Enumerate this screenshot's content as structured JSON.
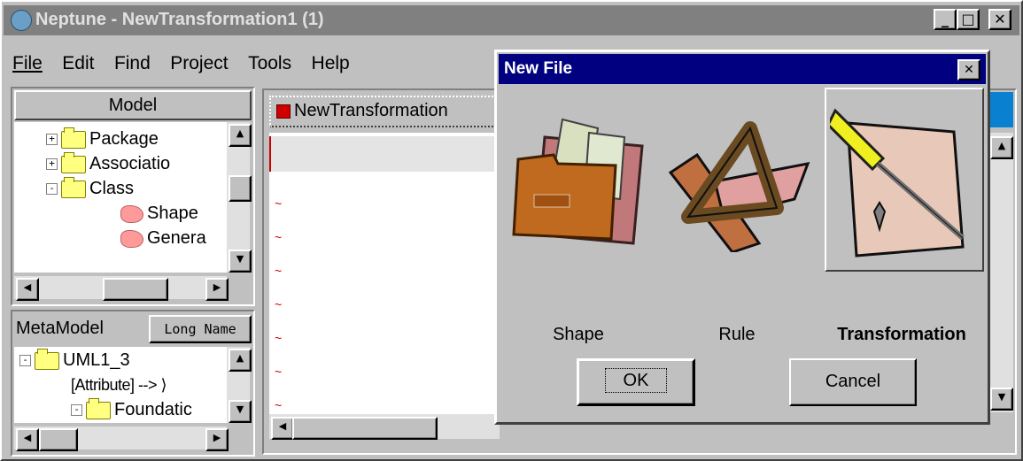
{
  "window": {
    "title": "Neptune - NewTransformation1 (1)",
    "controls": {
      "minimize": "_",
      "maximize": "□",
      "close": "✕"
    }
  },
  "menu": [
    "File",
    "Edit",
    "Find",
    "Project",
    "Tools",
    "Help"
  ],
  "model_panel": {
    "header": "Model",
    "items": [
      {
        "label": "Package",
        "icon": "folder-icon",
        "expand": "+"
      },
      {
        "label": "Associatio",
        "icon": "folder-icon",
        "expand": "+"
      },
      {
        "label": "Class",
        "icon": "open-folder-icon",
        "expand": "-"
      },
      {
        "label": "Shape",
        "icon": "shape-blob-icon"
      },
      {
        "label": "Genera",
        "icon": "shape-blob-icon"
      }
    ]
  },
  "metamodel_panel": {
    "header": "MetaModel",
    "long_name_button": "Long Name",
    "items": [
      {
        "label": "UML1_3",
        "icon": "open-folder-icon",
        "expand": "-"
      },
      {
        "label": "[Attribute] --> ⟩",
        "icon": ""
      },
      {
        "label": "Foundatic",
        "icon": "open-folder-icon",
        "expand": "-"
      }
    ]
  },
  "editor": {
    "tab_label": "NewTransformation"
  },
  "dialog": {
    "title": "New File",
    "options": [
      {
        "label": "Shape",
        "icon": "folder-papers-icon",
        "selected": false
      },
      {
        "label": "Rule",
        "icon": "set-square-ruler-icon",
        "selected": false
      },
      {
        "label": "Transformation",
        "icon": "screwdriver-icon",
        "selected": true
      }
    ],
    "ok_label": "OK",
    "cancel_label": "Cancel"
  },
  "colors": {
    "dialog_title_bg": "#000080",
    "window_title_bg": "#808080",
    "accent_blue": "#0a80d0"
  }
}
